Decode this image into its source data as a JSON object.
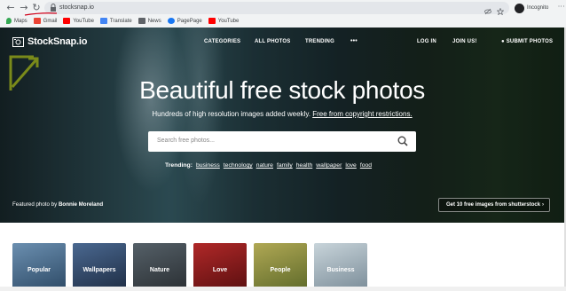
{
  "browser": {
    "url": "stocksnap.io",
    "profile_label": "Incognito",
    "bookmarks": [
      {
        "label": "Maps",
        "color": "#34a853"
      },
      {
        "label": "Gmail",
        "color": "#ea4335"
      },
      {
        "label": "YouTube",
        "color": "#ff0000"
      },
      {
        "label": "Translate",
        "color": "#4285f4"
      },
      {
        "label": "News",
        "color": "#5f6368"
      },
      {
        "label": "PagePage",
        "color": "#1877f2"
      },
      {
        "label": "YouTube",
        "color": "#ff0000"
      }
    ]
  },
  "header": {
    "logo_text": "StockSnap.io",
    "nav": {
      "categories": "CATEGORIES",
      "all_photos": "ALL PHOTOS",
      "trending": "TRENDING",
      "more": "•••",
      "login": "LOG IN",
      "join": "JOIN US!",
      "submit": "SUBMIT PHOTOS"
    }
  },
  "hero": {
    "title": "Beautiful free stock photos",
    "subtitle_main": "Hundreds of high resolution images added weekly. ",
    "subtitle_link": "Free from copyright restrictions.",
    "search_placeholder": "Search free photos...",
    "trending_label": "Trending:",
    "trending_tags": [
      "business",
      "technology",
      "nature",
      "family",
      "health",
      "wallpaper",
      "love",
      "food"
    ],
    "featured_prefix": "Featured photo by ",
    "featured_author": "Bonnie Moreland",
    "shutterstock_cta": "Get 10 free images from shutterstock"
  },
  "categories": [
    {
      "label": "Popular",
      "color": "#4a6a8a"
    },
    {
      "label": "Wallpapers",
      "color": "#2c3e5c"
    },
    {
      "label": "Nature",
      "color": "#3a3f44"
    },
    {
      "label": "Love",
      "color": "#8b1a1a"
    },
    {
      "label": "People",
      "color": "#8a8a3a"
    },
    {
      "label": "Business",
      "color": "#9aa8b0"
    }
  ],
  "colors": {
    "annotation_arrow": "#7a8a1a",
    "annotation_underline": "#d0021b"
  }
}
